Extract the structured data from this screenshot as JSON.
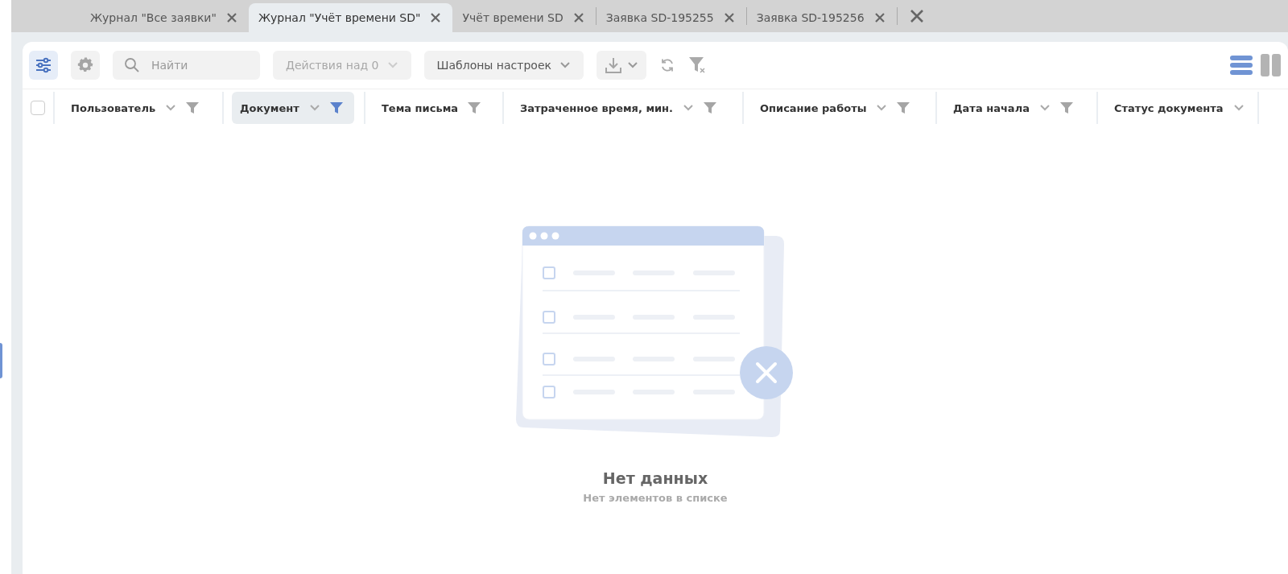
{
  "tabs": [
    {
      "label": "Журнал \"Все заявки\"",
      "selected": false
    },
    {
      "label": "Журнал \"Учёт времени SD\"",
      "selected": true
    },
    {
      "label": "Учёт времени SD",
      "selected": false
    },
    {
      "label": "Заявка SD-195255",
      "selected": false
    },
    {
      "label": "Заявка SD-195256",
      "selected": false
    }
  ],
  "toolbar": {
    "settings_panel_active": true,
    "search": {
      "placeholder": "Найти"
    },
    "actions": {
      "label": "Действия над 0",
      "disabled": true
    },
    "templates": {
      "label": "Шаблоны настроек"
    },
    "view_modes": [
      {
        "kind": "list",
        "selected": true
      },
      {
        "kind": "columns",
        "selected": false
      }
    ]
  },
  "table": {
    "select_all": {
      "checked": false
    },
    "columns": [
      {
        "label": "Пользователь",
        "has_sort": true,
        "has_filter": true,
        "filtered": false
      },
      {
        "label": "Документ",
        "has_sort": true,
        "has_filter": true,
        "filtered": true
      },
      {
        "label": "Тема письма",
        "has_sort": false,
        "has_filter": true,
        "filtered": false
      },
      {
        "label": "Затраченное время, мин.",
        "has_sort": true,
        "has_filter": true,
        "filtered": false
      },
      {
        "label": "Описание работы",
        "has_sort": true,
        "has_filter": true,
        "filtered": false
      },
      {
        "label": "Дата начала",
        "has_sort": true,
        "has_filter": true,
        "filtered": false
      },
      {
        "label": "Статус документа",
        "has_sort": true,
        "has_filter": false,
        "filtered": false
      }
    ]
  },
  "empty_state": {
    "title": "Нет данных",
    "subtitle": "Нет элементов в списке"
  }
}
